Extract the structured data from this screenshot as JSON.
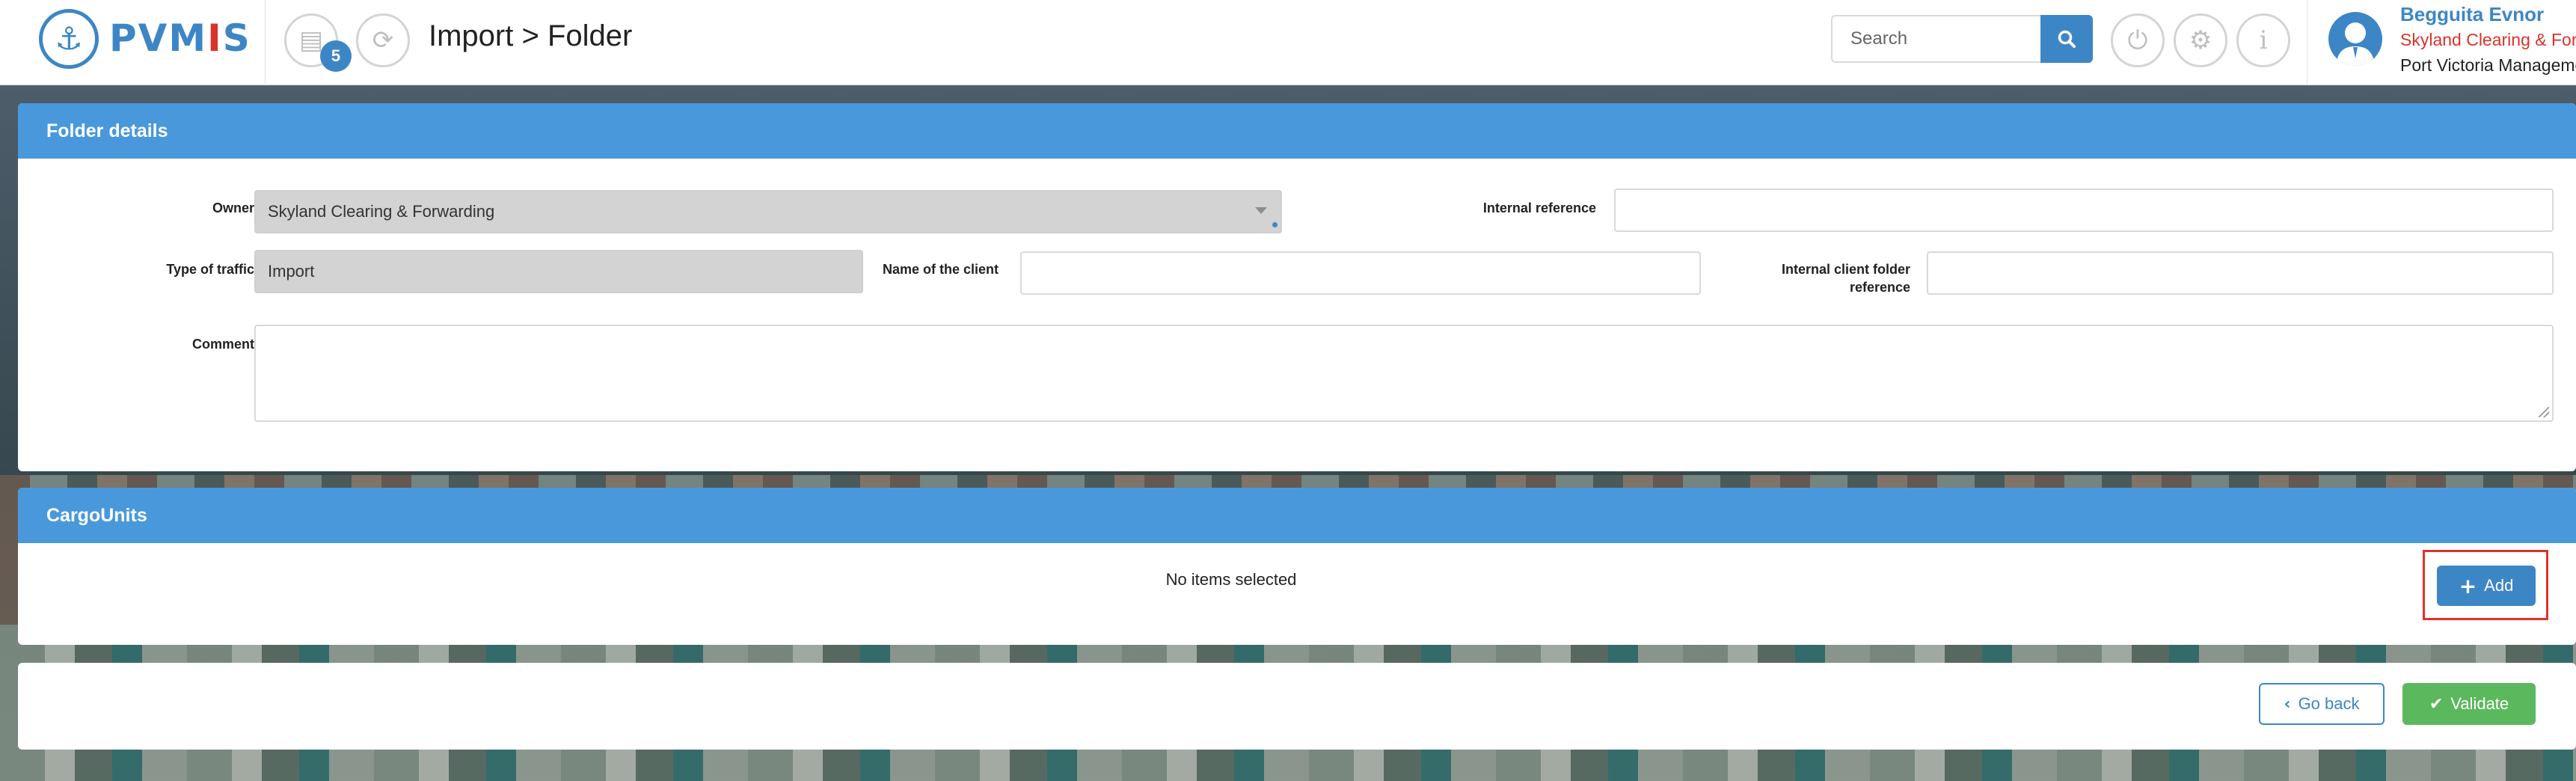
{
  "header": {
    "logo_text_a": "PVM",
    "logo_text_b": "I",
    "logo_text_c": "S",
    "notifications_count": "5",
    "page_title": "Import > Folder",
    "search_placeholder": "Search",
    "user": {
      "name": "Begguita Evnor",
      "company": "Skyland Clearing & Forwarding",
      "organization": "Port Victoria Management"
    }
  },
  "folder_details": {
    "title": "Folder details",
    "owner_label": "Owner",
    "owner_value": "Skyland Clearing & Forwarding",
    "internal_reference_label": "Internal reference",
    "internal_reference_value": "",
    "type_of_traffic_label": "Type of traffic",
    "type_of_traffic_value": "Import",
    "name_of_client_label": "Name of the client",
    "name_of_client_value": "",
    "internal_client_folder_reference_label_1": "Internal client folder",
    "internal_client_folder_reference_label_2": "reference",
    "internal_client_folder_reference_value": "",
    "comment_label": "Comment",
    "comment_value": ""
  },
  "cargo_units": {
    "title": "CargoUnits",
    "empty_message": "No items selected",
    "add_label": "Add"
  },
  "footer": {
    "go_back_label": "Go back",
    "validate_label": "Validate"
  },
  "colors": {
    "primary": "#4a98dc",
    "accent": "#3d86c6",
    "success": "#5cb85c",
    "highlight": "#e0322b"
  }
}
